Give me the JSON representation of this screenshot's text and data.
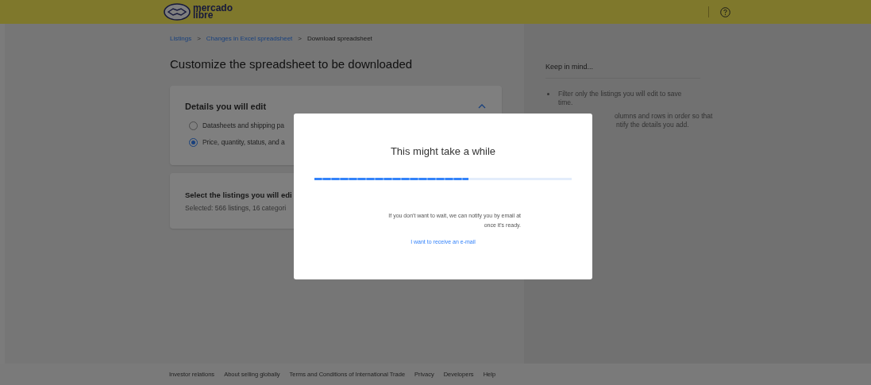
{
  "header": {
    "logo_text": [
      "mercado",
      "libre"
    ]
  },
  "breadcrumb": [
    {
      "label": "Listings",
      "link": true
    },
    {
      "label": "Changes in Excel spreadsheet",
      "link": true
    },
    {
      "label": "Download spreadsheet",
      "link": false
    }
  ],
  "breadcrumb_separator": ">",
  "page_title": "Customize the spreadsheet to be downloaded",
  "details_card": {
    "title": "Details you will edit",
    "expanded": true,
    "options": [
      {
        "label": "Datasheets and shipping pa",
        "selected": false
      },
      {
        "label": "Price, quantity, status, and a",
        "selected": true
      }
    ]
  },
  "listings_card": {
    "title": "Select the listings you will edi",
    "subtitle": "Selected: 566 listings, 16 categori"
  },
  "side_panel": {
    "title": "Keep in mind...",
    "tips": [
      {
        "lines": [
          "Filter only the listings you will edit to save",
          "time."
        ],
        "bullet_visible": true
      },
      {
        "lines": [
          "olumns and rows in order so that",
          "ntify the details you add."
        ],
        "bullet_visible": false
      }
    ]
  },
  "footer_links": [
    "Investor relations",
    "About selling globally",
    "Terms and Conditions of International Trade",
    "Privacy",
    "Developers",
    "Help"
  ],
  "modal": {
    "title": "This might take a while",
    "progress": {
      "level": 0.6
    },
    "message": [
      "If you don't want to wait, we can notify you by email at",
      "once it's ready."
    ],
    "link": "I want to receive an e-mail"
  }
}
